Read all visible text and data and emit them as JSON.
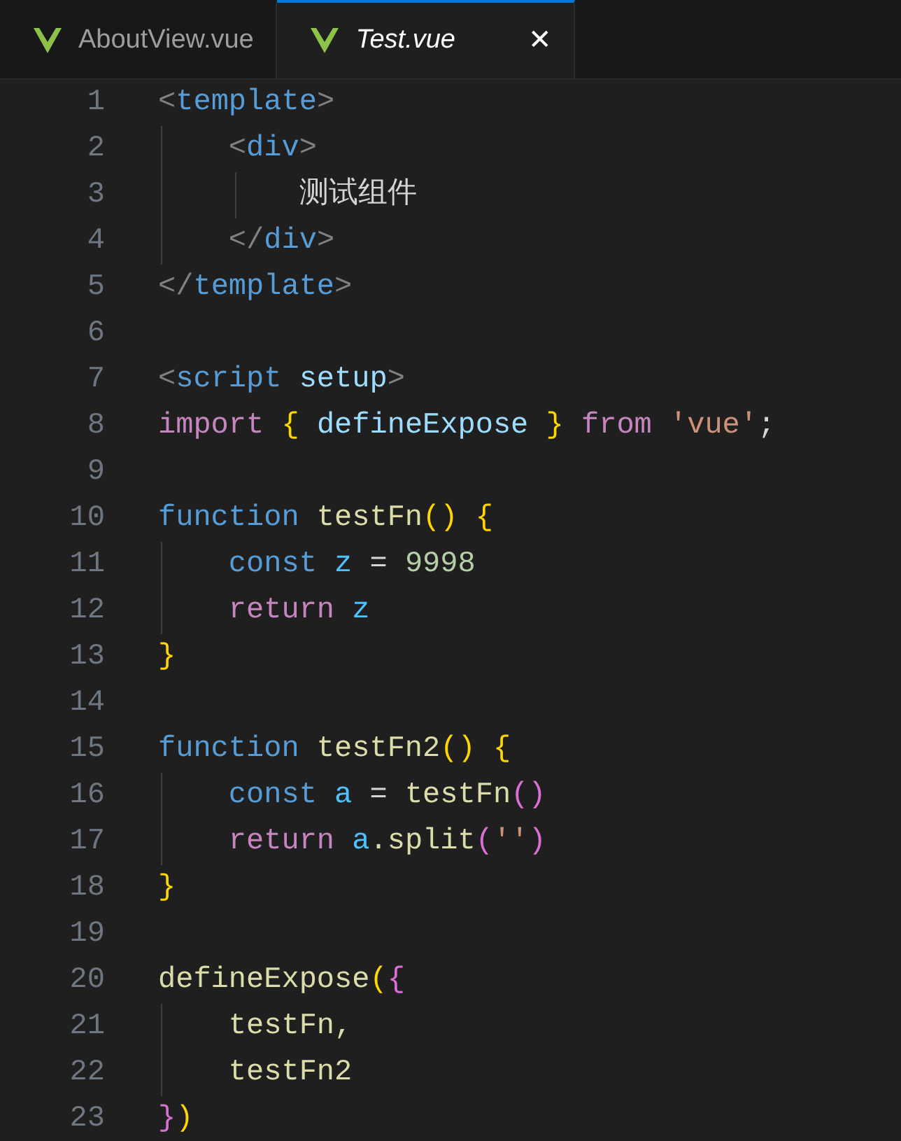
{
  "tabs": [
    {
      "label": "AboutView.vue",
      "selected": false,
      "preview": false
    },
    {
      "label": "Test.vue",
      "selected": true,
      "preview": true,
      "close": "✕"
    }
  ],
  "editor": {
    "lines": [
      {
        "number": "1",
        "tokens": [
          {
            "text": "<",
            "kind": "punct"
          },
          {
            "text": "template",
            "kind": "tag"
          },
          {
            "text": ">",
            "kind": "punct"
          }
        ]
      },
      {
        "number": "2",
        "tokens": [
          {
            "text": "    <",
            "kind": "punct"
          },
          {
            "text": "div",
            "kind": "tag"
          },
          {
            "text": ">",
            "kind": "punct"
          }
        ]
      },
      {
        "number": "3",
        "tokens": [
          {
            "text": "        测试组件",
            "kind": "text"
          }
        ]
      },
      {
        "number": "4",
        "tokens": [
          {
            "text": "    </",
            "kind": "punct"
          },
          {
            "text": "div",
            "kind": "tag"
          },
          {
            "text": ">",
            "kind": "punct"
          }
        ]
      },
      {
        "number": "5",
        "tokens": [
          {
            "text": "</",
            "kind": "punct"
          },
          {
            "text": "template",
            "kind": "tag"
          },
          {
            "text": ">",
            "kind": "punct"
          }
        ]
      },
      {
        "number": "6"
      },
      {
        "number": "7",
        "tokens": [
          {
            "text": "<",
            "kind": "punct"
          },
          {
            "text": "script ",
            "kind": "tag"
          },
          {
            "text": "setup",
            "kind": "attr"
          },
          {
            "text": ">",
            "kind": "punct"
          }
        ]
      },
      {
        "number": "8",
        "tokens": [
          {
            "text": "import ",
            "kind": "control"
          },
          {
            "text": "{ ",
            "kind": "bracket1"
          },
          {
            "text": "defineExpose ",
            "kind": "var"
          },
          {
            "text": "} ",
            "kind": "bracket1"
          },
          {
            "text": "from ",
            "kind": "control"
          },
          {
            "text": "'vue'",
            "kind": "string"
          },
          {
            "text": ";",
            "kind": "text"
          }
        ]
      },
      {
        "number": "9"
      },
      {
        "number": "10",
        "tokens": [
          {
            "text": "function ",
            "kind": "storage"
          },
          {
            "text": "testFn",
            "kind": "fn"
          },
          {
            "text": "() {",
            "kind": "bracket1"
          }
        ]
      },
      {
        "number": "11",
        "tokens": [
          {
            "text": "    const ",
            "kind": "storage"
          },
          {
            "text": "z",
            "kind": "const"
          },
          {
            "text": " = ",
            "kind": "text"
          },
          {
            "text": "9998",
            "kind": "number"
          }
        ]
      },
      {
        "number": "12",
        "tokens": [
          {
            "text": "    return ",
            "kind": "control"
          },
          {
            "text": "z",
            "kind": "const"
          }
        ]
      },
      {
        "number": "13",
        "tokens": [
          {
            "text": "}",
            "kind": "bracket1"
          }
        ]
      },
      {
        "number": "14"
      },
      {
        "number": "15",
        "tokens": [
          {
            "text": "function ",
            "kind": "storage"
          },
          {
            "text": "testFn2",
            "kind": "fn"
          },
          {
            "text": "() {",
            "kind": "bracket1"
          }
        ]
      },
      {
        "number": "16",
        "tokens": [
          {
            "text": "    const ",
            "kind": "storage"
          },
          {
            "text": "a",
            "kind": "const"
          },
          {
            "text": " = ",
            "kind": "text"
          },
          {
            "text": "testFn",
            "kind": "fn"
          },
          {
            "text": "()",
            "kind": "bracket2"
          }
        ]
      },
      {
        "number": "17",
        "tokens": [
          {
            "text": "    return ",
            "kind": "control"
          },
          {
            "text": "a",
            "kind": "const"
          },
          {
            "text": ".split",
            "kind": "fn"
          },
          {
            "text": "(",
            "kind": "bracket2"
          },
          {
            "text": "''",
            "kind": "string"
          },
          {
            "text": ")",
            "kind": "bracket2"
          }
        ]
      },
      {
        "number": "18",
        "tokens": [
          {
            "text": "}",
            "kind": "bracket1"
          }
        ]
      },
      {
        "number": "19"
      },
      {
        "number": "20",
        "tokens": [
          {
            "text": "defineExpose",
            "kind": "fn"
          },
          {
            "text": "(",
            "kind": "bracket1"
          },
          {
            "text": "{",
            "kind": "bracket2"
          }
        ]
      },
      {
        "number": "21",
        "tokens": [
          {
            "text": "    testFn,",
            "kind": "fn"
          }
        ]
      },
      {
        "number": "22",
        "tokens": [
          {
            "text": "    testFn2",
            "kind": "fn"
          }
        ]
      },
      {
        "number": "23",
        "tokens": [
          {
            "text": "}",
            "kind": "bracket2"
          },
          {
            "text": ")",
            "kind": "bracket1"
          }
        ]
      }
    ]
  }
}
